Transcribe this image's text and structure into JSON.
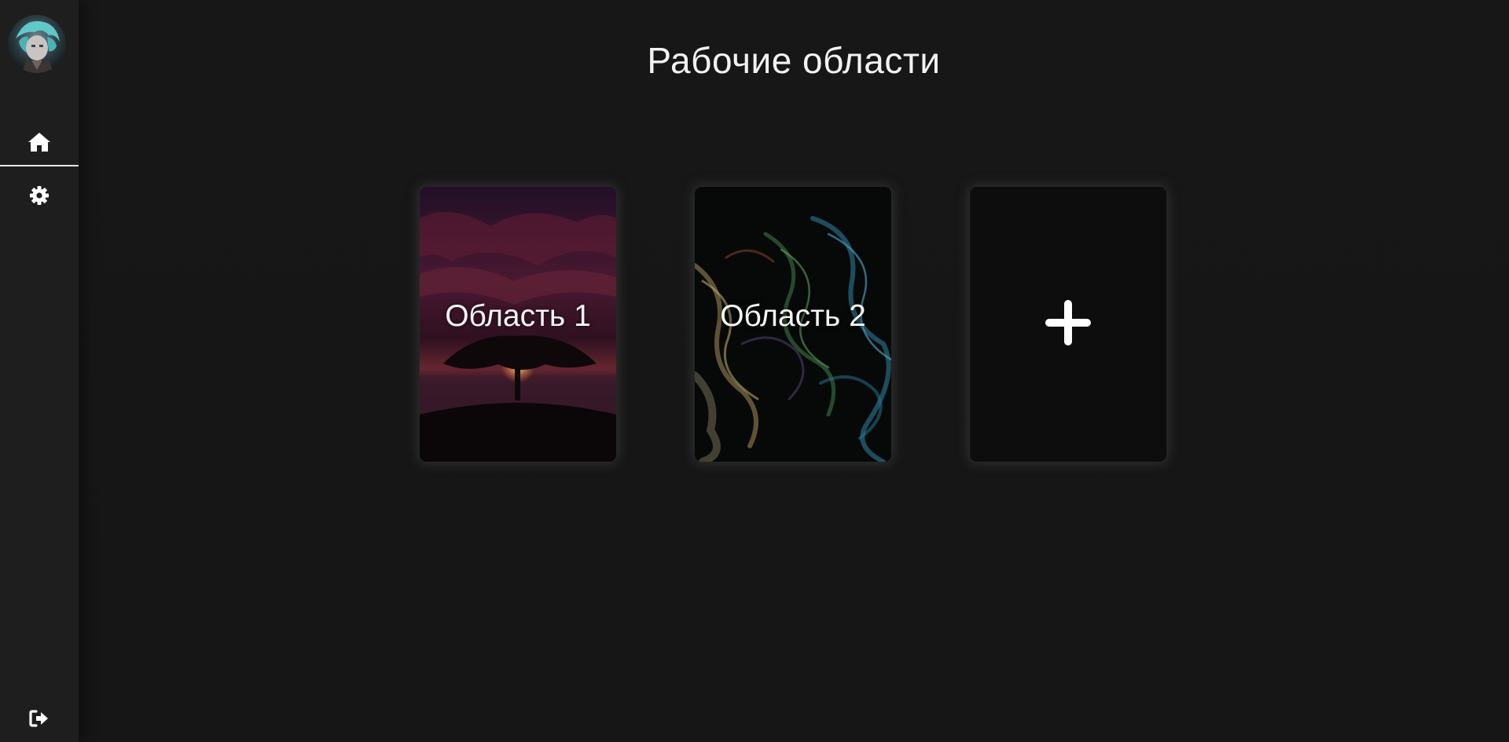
{
  "page": {
    "title": "Рабочие области"
  },
  "sidebar": {
    "items": [
      {
        "icon": "home-icon",
        "active": true
      },
      {
        "icon": "gear-icon",
        "active": false
      }
    ],
    "bottom": {
      "icon": "logout-icon"
    }
  },
  "workspaces": [
    {
      "label": "Область 1"
    },
    {
      "label": "Область 2"
    }
  ],
  "add_card": {
    "icon": "plus-icon"
  },
  "colors": {
    "background": "#161616",
    "sidebar": "#1e1e1e",
    "card": "#0d0d0d",
    "text": "#ffffff"
  }
}
